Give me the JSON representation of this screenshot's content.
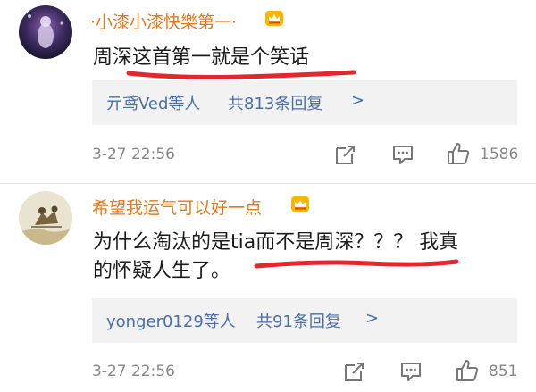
{
  "comments": [
    {
      "username": "·小漆小漆快樂第一·",
      "text_lines": [
        "周深这首第一就是个笑话"
      ],
      "reply_users": "亓鸢Ved等人",
      "reply_count": "共813条回复",
      "reply_chevron": ">",
      "time": "3-27 22:56",
      "likes": "1586"
    },
    {
      "username": "希望我运气可以好一点",
      "text_lines": [
        "为什么淘汰的是tia而不是周深？？？ 我真",
        "的怀疑人生了。"
      ],
      "reply_users": "yonger0129等人",
      "reply_count": "共91条回复",
      "reply_chevron": ">",
      "time": "3-27 22:56",
      "likes": "851"
    }
  ],
  "colors": {
    "username": "#e8771a",
    "link": "#4a6ea6",
    "annotation": "#e0282e",
    "meta": "#888888"
  },
  "icons": [
    "crown-badge-icon",
    "share-icon",
    "comment-icon",
    "like-icon"
  ]
}
